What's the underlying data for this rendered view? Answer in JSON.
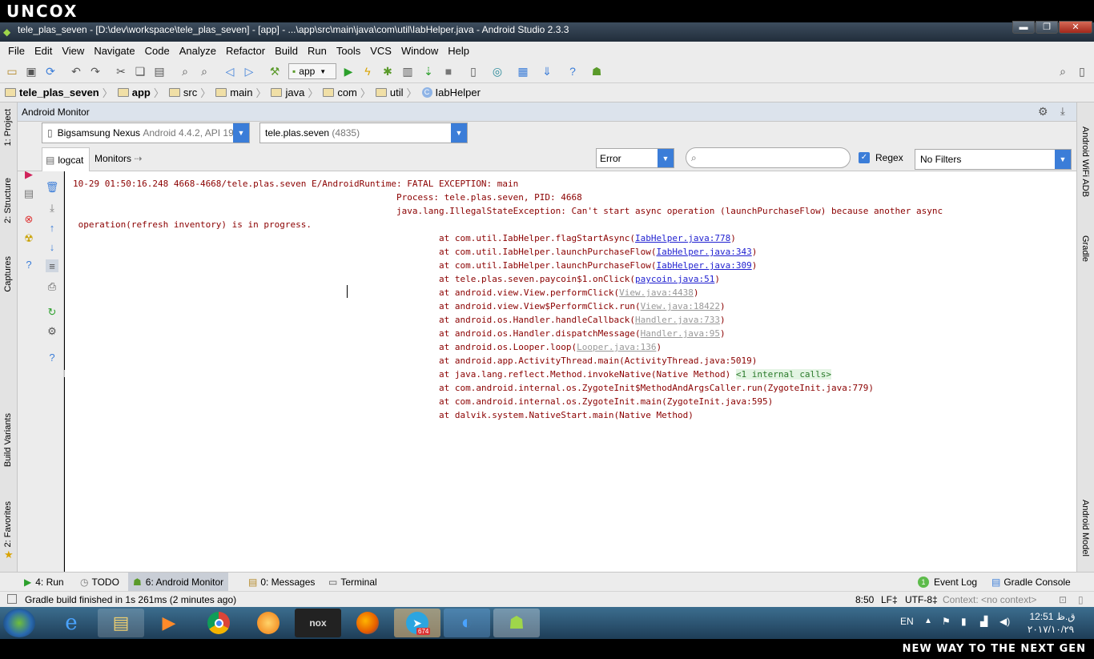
{
  "brand": "UNCOX",
  "window": {
    "title": "tele_plas_seven - [D:\\dev\\workspace\\tele_plas_seven] - [app] - ...\\app\\src\\main\\java\\com\\util\\IabHelper.java - Android Studio 2.3.3",
    "controls": [
      "minimize",
      "maximize",
      "close"
    ]
  },
  "menu": [
    "File",
    "Edit",
    "View",
    "Navigate",
    "Code",
    "Analyze",
    "Refactor",
    "Build",
    "Run",
    "Tools",
    "VCS",
    "Window",
    "Help"
  ],
  "toolbar": {
    "run_config": "app"
  },
  "breadcrumb": [
    "tele_plas_seven",
    "app",
    "src",
    "main",
    "java",
    "com",
    "util",
    "IabHelper"
  ],
  "left_tool_tabs": [
    "1: Project",
    "2: Structure",
    "Captures",
    "Build Variants",
    "2: Favorites"
  ],
  "right_tool_tabs": [
    "Android WiFi ADB",
    "Gradle",
    "Android Model"
  ],
  "panel": {
    "title": "Android Monitor"
  },
  "device_select": {
    "name": "Bigsamsung Nexus",
    "detail": "Android 4.4.2, API 19"
  },
  "process_select": {
    "name": "tele.plas.seven",
    "pid": "(4835)"
  },
  "tabs": {
    "logcat": "logcat",
    "monitors": "Monitors"
  },
  "filters": {
    "level": "Error",
    "search_value": "",
    "regex_label": "Regex",
    "regex_checked": true,
    "filter": "No Filters"
  },
  "log": {
    "header": "10-29 01:50:16.248 4668-4668/tele.plas.seven E/AndroidRuntime: FATAL EXCEPTION: main",
    "process": "Process: tele.plas.seven, PID: 4668",
    "exception": "java.lang.IllegalStateException: Can't start async operation (launchPurchaseFlow) because another async",
    "exception_cont": "operation(refresh inventory) is in progress.",
    "frames": [
      {
        "method": "at com.util.IabHelper.flagStartAsync(",
        "link": "IabHelper.java:778",
        "end": ")",
        "style": "link"
      },
      {
        "method": "at com.util.IabHelper.launchPurchaseFlow(",
        "link": "IabHelper.java:343",
        "end": ")",
        "style": "link"
      },
      {
        "method": "at com.util.IabHelper.launchPurchaseFlow(",
        "link": "IabHelper.java:309",
        "end": ")",
        "style": "link"
      },
      {
        "method": "at tele.plas.seven.paycoin$1.onClick(",
        "link": "paycoin.java:51",
        "end": ")",
        "style": "link"
      },
      {
        "method": "at android.view.View.performClick(",
        "link": "View.java:4438",
        "end": ")",
        "style": "dim"
      },
      {
        "method": "at android.view.View$PerformClick.run(",
        "link": "View.java:18422",
        "end": ")",
        "style": "dim"
      },
      {
        "method": "at android.os.Handler.handleCallback(",
        "link": "Handler.java:733",
        "end": ")",
        "style": "dim"
      },
      {
        "method": "at android.os.Handler.dispatchMessage(",
        "link": "Handler.java:95",
        "end": ")",
        "style": "dim"
      },
      {
        "method": "at android.os.Looper.loop(",
        "link": "Looper.java:136",
        "end": ")",
        "style": "dim"
      },
      {
        "method": "at android.app.ActivityThread.main(ActivityThread.java:5019)",
        "link": "",
        "end": "",
        "style": "plain"
      },
      {
        "method": "at java.lang.reflect.Method.invokeNative(Native Method) ",
        "link": "<1 internal calls>",
        "end": "",
        "style": "badge"
      },
      {
        "method": "at com.android.internal.os.ZygoteInit$MethodAndArgsCaller.run(ZygoteInit.java:779)",
        "link": "",
        "end": "",
        "style": "plain"
      },
      {
        "method": "at com.android.internal.os.ZygoteInit.main(ZygoteInit.java:595)",
        "link": "",
        "end": "",
        "style": "plain"
      },
      {
        "method": "at dalvik.system.NativeStart.main(Native Method)",
        "link": "",
        "end": "",
        "style": "plain"
      }
    ]
  },
  "bottom_tabs": {
    "run": "4: Run",
    "todo": "TODO",
    "monitor": "6: Android Monitor",
    "messages": "0: Messages",
    "terminal": "Terminal",
    "event_log": "Event Log",
    "event_count": "1",
    "gradle_console": "Gradle Console"
  },
  "status": {
    "message": "Gradle build finished in 1s 261ms (2 minutes ago)",
    "position": "8:50",
    "line_sep": "LF",
    "encoding": "UTF-8",
    "context": "Context: <no context>"
  },
  "taskbar": {
    "lang": "EN",
    "time": "12:51 ق.ظ",
    "date": "۲۰۱۷/۱۰/۲۹",
    "telegram_badge": "674"
  },
  "footer": "NEW WAY TO THE NEXT GEN"
}
